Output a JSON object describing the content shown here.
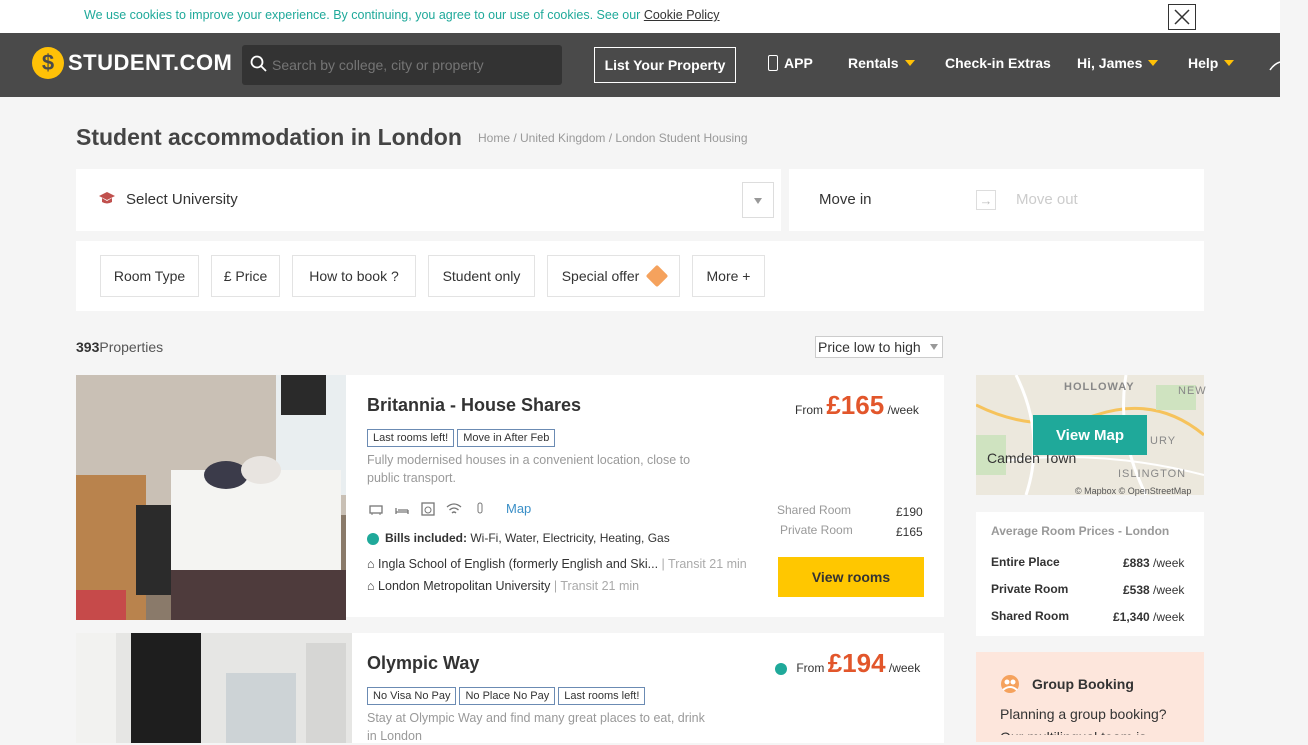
{
  "cookie": {
    "text": "We use cookies to improve your experience. By continuing, you agree to our use of cookies. See our",
    "link": "Cookie Policy"
  },
  "header": {
    "logo": "STUDENT.COM",
    "search_placeholder": "Search by college, city or property",
    "list_property": "List Your Property",
    "app": "APP",
    "rentals": "Rentals",
    "checkin": "Check-in Extras",
    "user": "Hi, James",
    "help": "Help"
  },
  "page": {
    "title": "Student accommodation in London",
    "breadcrumb": "Home / United Kingdom / London Student Housing"
  },
  "search_panel": {
    "university": "Select University",
    "move_in": "Move in",
    "arrow": "→",
    "move_out": "Move out"
  },
  "filters": [
    "Room Type",
    "£ Price",
    "How to book ?",
    "Student only",
    "Special offer",
    "More +"
  ],
  "results": {
    "count": "393",
    "count_label": "Properties",
    "sort": "Price low to high"
  },
  "listings": [
    {
      "name": "Britannia - House Shares",
      "badges": [
        "Last rooms left!",
        "Move in After Feb"
      ],
      "description": "Fully modernised houses in a convenient location, close to public transport.",
      "map": "Map",
      "bills_label": "Bills included:",
      "bills": "Wi-Fi, Water, Electricity, Heating, Gas",
      "schools": [
        {
          "name": "Ingla School of English (formerly English and Ski...",
          "transit": "| Transit 21 min"
        },
        {
          "name": "London Metropolitan University",
          "transit": "| Transit 21 min"
        }
      ],
      "from": "From",
      "price": "£165",
      "per": "/week",
      "rooms": [
        {
          "label": "Shared Room",
          "price": "£190"
        },
        {
          "label": "Private Room",
          "price": "£165"
        }
      ],
      "cta": "View rooms"
    },
    {
      "name": "Olympic Way",
      "badges": [
        "No Visa No Pay",
        "No Place No Pay",
        "Last rooms left!"
      ],
      "description": "Stay at Olympic Way and find many great places to eat, drink in London",
      "from": "From",
      "price": "£194",
      "per": "/week"
    }
  ],
  "map": {
    "labels": [
      "HOLLOWAY",
      "NEW",
      "Camden Town",
      "ISLINGTON",
      "URY"
    ],
    "view_map": "View Map",
    "attribution": "© Mapbox © OpenStreetMap"
  },
  "avg_prices": {
    "title": "Average Room Prices - London",
    "rows": [
      {
        "label": "Entire Place",
        "price": "£883",
        "per": "/week"
      },
      {
        "label": "Private Room",
        "price": "£538",
        "per": "/week"
      },
      {
        "label": "Shared Room",
        "price": "£1,340",
        "per": "/week"
      }
    ]
  },
  "group": {
    "title": "Group Booking",
    "question": "Planning a group booking?",
    "partial": "Our multilingual team is"
  },
  "colors": {
    "accent": "#1fa99a",
    "price": "#e2562b",
    "cta": "#ffc700",
    "header": "#4a4a4a"
  }
}
